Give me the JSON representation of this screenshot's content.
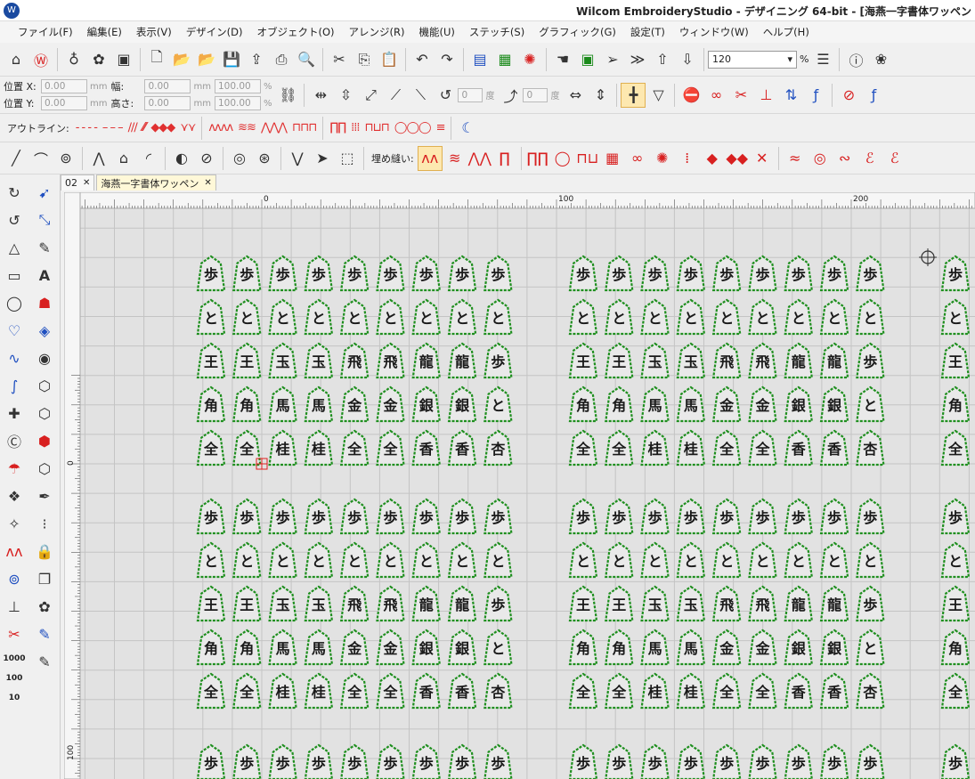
{
  "window": {
    "title": "Wilcom EmbroideryStudio - デザイニング 64-bit - [海燕一字書体ワッペン"
  },
  "menu": [
    "ファイル(F)",
    "編集(E)",
    "表示(V)",
    "デザイン(D)",
    "オブジェクト(O)",
    "アレンジ(R)",
    "機能(U)",
    "ステッチ(S)",
    "グラフィック(G)",
    "設定(T)",
    "ウィンドウ(W)",
    "ヘルプ(H)"
  ],
  "toolbar": {
    "zoom_value": "120",
    "zoom_unit": "%",
    "pos_x_label": "位置 X:",
    "pos_y_label": "位置 Y:",
    "width_label": "幅:",
    "height_label": "高さ:",
    "pos_x": "0.00",
    "pos_y": "0.00",
    "width": "0.00",
    "height": "0.00",
    "scale_w": "100.00",
    "scale_h": "100.00",
    "unit_mm": "mm",
    "unit_pct": "%",
    "rotate_value": "0",
    "slant_value": "0",
    "deg": "度",
    "outline_label": "アウトライン:",
    "fill_label": "埋め縫い:"
  },
  "tabs": [
    {
      "label": "02"
    },
    {
      "label": "海燕一字書体ワッペン"
    }
  ],
  "ruler": {
    "top_labels": [
      "0",
      "100",
      "200"
    ],
    "left_labels": [
      "0",
      "100"
    ]
  },
  "design": {
    "piece_outline_color": "#1f8f1f",
    "piece_fill_color": "#e9e9e9",
    "glyph_color": "#1a1a1a",
    "rows": [
      [
        "歩",
        "歩",
        "歩",
        "歩",
        "歩",
        "歩",
        "歩",
        "歩",
        "歩"
      ],
      [
        "と",
        "と",
        "と",
        "と",
        "と",
        "と",
        "と",
        "と",
        "と"
      ],
      [
        "王",
        "王",
        "玉",
        "玉",
        "飛",
        "飛",
        "龍",
        "龍",
        "歩"
      ],
      [
        "角",
        "角",
        "馬",
        "馬",
        "金",
        "金",
        "銀",
        "銀",
        "と"
      ],
      [
        "全",
        "全",
        "桂",
        "桂",
        "全",
        "全",
        "香",
        "香",
        "杏"
      ]
    ]
  }
}
